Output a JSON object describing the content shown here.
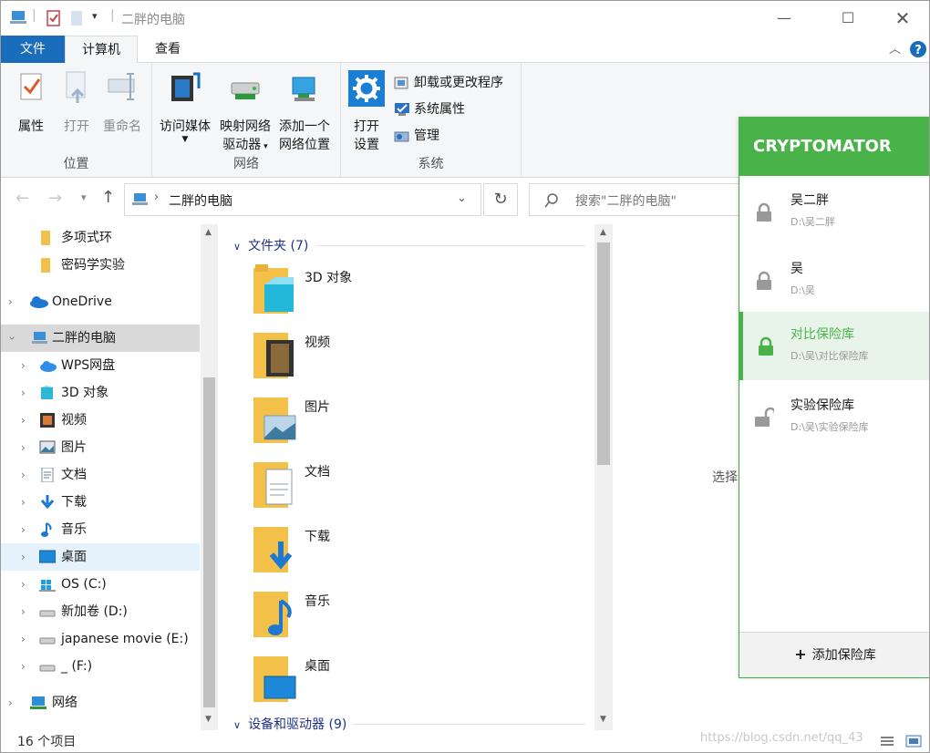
{
  "window": {
    "title": "二胖的电脑"
  },
  "ribbon": {
    "tabs": [
      "文件",
      "计算机",
      "查看"
    ],
    "location": {
      "label": "位置",
      "properties": "属性",
      "open": "打开",
      "rename": "重命名"
    },
    "network": {
      "label": "网络",
      "access_media": "访问媒体",
      "map_drive_1": "映射网络",
      "map_drive_2": "驱动器",
      "add_location_1": "添加一个",
      "add_location_2": "网络位置"
    },
    "system": {
      "label": "系统",
      "open_settings_1": "打开",
      "open_settings_2": "设置",
      "uninstall": "卸载或更改程序",
      "sys_props": "系统属性",
      "manage": "管理"
    }
  },
  "address": {
    "path": "二胖的电脑",
    "search_placeholder": "搜索\"二胖的电脑\""
  },
  "nav": [
    {
      "label": "多项式环",
      "icon": "folder-icon"
    },
    {
      "label": "密码学实验",
      "icon": "folder-icon"
    },
    {
      "label": "OneDrive",
      "icon": "onedrive-icon"
    },
    {
      "label": "二胖的电脑",
      "icon": "computer-icon"
    },
    {
      "label": "WPS网盘",
      "icon": "cloud-icon"
    },
    {
      "label": "3D 对象",
      "icon": "cube-icon"
    },
    {
      "label": "视频",
      "icon": "film-icon"
    },
    {
      "label": "图片",
      "icon": "picture-icon"
    },
    {
      "label": "文档",
      "icon": "document-icon"
    },
    {
      "label": "下载",
      "icon": "download-icon"
    },
    {
      "label": "音乐",
      "icon": "music-icon"
    },
    {
      "label": "桌面",
      "icon": "desktop-icon"
    },
    {
      "label": "OS (C:)",
      "icon": "windows-drive-icon"
    },
    {
      "label": "新加卷 (D:)",
      "icon": "drive-icon"
    },
    {
      "label": "japanese movie (E:)",
      "icon": "drive-icon"
    },
    {
      "label": "_ (F:)",
      "icon": "drive-icon"
    },
    {
      "label": "网络",
      "icon": "network-icon"
    }
  ],
  "content": {
    "folders_header": "文件夹 (7)",
    "devices_header": "设备和驱动器 (9)",
    "folders": [
      "3D 对象",
      "视频",
      "图片",
      "文档",
      "下载",
      "音乐",
      "桌面"
    ]
  },
  "status": {
    "count": "16 个项目"
  },
  "preview": {
    "hint": "选择"
  },
  "cryptomator": {
    "brand": "CRYPTOMATOR",
    "vaults": [
      {
        "name": "吴二胖",
        "path": "D:\\吴二胖",
        "state": "locked"
      },
      {
        "name": "吴",
        "path": "D:\\吴",
        "state": "locked"
      },
      {
        "name": "对比保险库",
        "path": "D:\\吴\\对比保险库",
        "state": "locked-selected"
      },
      {
        "name": "实验保险库",
        "path": "D:\\吴\\实验保险库",
        "state": "unlocked"
      }
    ],
    "add_vault": "添加保险库"
  },
  "watermark": "https://blog.csdn.net/qq_43",
  "colors": {
    "accent": "#1a6dba",
    "crypto_green": "#49b34a",
    "folder_yellow": "#f3c04a"
  }
}
